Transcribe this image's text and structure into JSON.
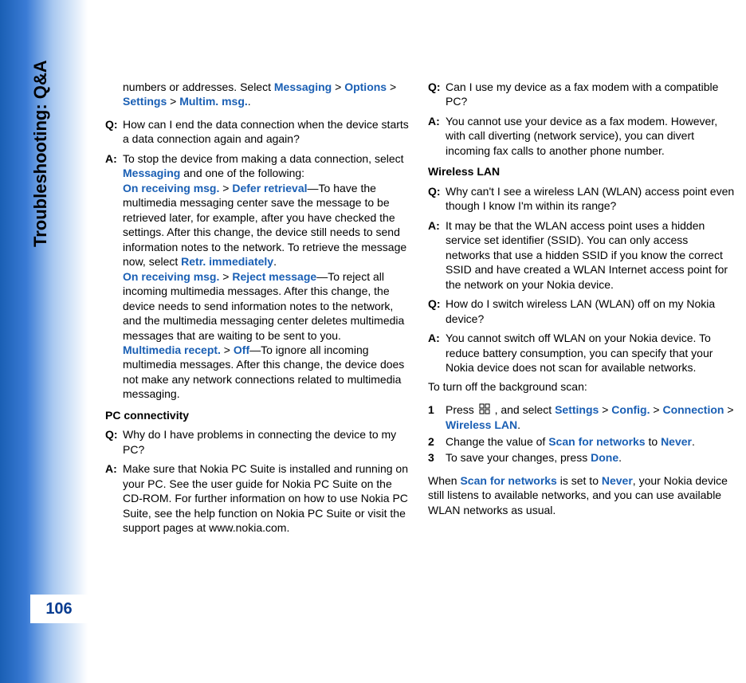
{
  "sidebar": {
    "title": "Troubleshooting: Q&A",
    "page_number": "106"
  },
  "col1": {
    "intro": {
      "pre": "numbers or addresses. Select ",
      "k1": "Messaging",
      "sep1": " > ",
      "k2": "Options",
      "sep2": " > ",
      "k3": "Settings",
      "sep3": " > ",
      "k4": "Multim. msg.",
      "post": "."
    },
    "q1": {
      "label": "Q:",
      "text": "How can I end the data connection when the device starts a data connection again and again?"
    },
    "a1": {
      "label": "A:",
      "line1_pre": "To stop the device from making a data connection, select ",
      "line1_k": "Messaging",
      "line1_post": " and one of the following:",
      "opt1_k1": "On receiving msg.",
      "opt1_sep": " > ",
      "opt1_k2": "Defer retrieval",
      "opt1_body": "—To have the multimedia messaging center save the message to be retrieved later, for example, after you have checked the settings. After this change, the device still needs to send information notes to the network. To retrieve the message now, select ",
      "opt1_k3": "Retr. immediately",
      "opt1_post": ".",
      "opt2_k1": "On receiving msg.",
      "opt2_sep": " > ",
      "opt2_k2": "Reject message",
      "opt2_body": "—To reject all incoming multimedia messages. After this change, the device needs to send information notes to the network, and the multimedia messaging center deletes multimedia messages that are waiting to be sent to you.",
      "opt3_k1": "Multimedia recept.",
      "opt3_sep": " > ",
      "opt3_k2": "Off",
      "opt3_body": "—To ignore all incoming multimedia messages. After this change, the device does not make any network connections related to multimedia messaging."
    },
    "sec_pc": "PC connectivity",
    "q2": {
      "label": "Q:",
      "text": "Why do I have problems in connecting the device to my PC?"
    },
    "a2": {
      "label": "A:",
      "text": "Make sure that Nokia PC Suite is installed and running on your PC. See the user guide for Nokia PC Suite on the CD-ROM. For further information on how to use Nokia PC Suite, see the help function on Nokia PC Suite or visit the support pages at www.nokia.com."
    }
  },
  "col2": {
    "q3": {
      "label": "Q:",
      "text": "Can I use my device as a fax modem with a compatible PC?"
    },
    "a3": {
      "label": "A:",
      "text": "You cannot use your device as a fax modem. However, with call diverting (network service), you can divert incoming fax calls to another phone number."
    },
    "sec_wlan": "Wireless LAN",
    "q4": {
      "label": "Q:",
      "text": "Why can't I see a wireless LAN (WLAN) access point even though I know I'm within its range?"
    },
    "a4": {
      "label": "A:",
      "text": "It may be that the WLAN access point uses a hidden service set identifier (SSID). You can only access networks that use a hidden SSID if you know the correct SSID and have created a WLAN Internet access point for the network on your Nokia device."
    },
    "q5": {
      "label": "Q:",
      "text": "How do I switch wireless LAN (WLAN) off on my Nokia device?"
    },
    "a5": {
      "label": "A:",
      "text": "You cannot switch off WLAN on your Nokia device. To reduce battery consumption, you can specify that your Nokia device does not scan for available networks."
    },
    "scan_intro": "To turn off the background scan:",
    "list": {
      "n1": "1",
      "i1_pre": "Press ",
      "i1_mid": " , and select ",
      "i1_k1": "Settings",
      "i1_s1": " > ",
      "i1_k2": "Config.",
      "i1_s2": " > ",
      "i1_k3": "Connection",
      "i1_s3": " > ",
      "i1_k4": "Wireless LAN",
      "i1_post": ".",
      "n2": "2",
      "i2_pre": "Change the value of ",
      "i2_k1": "Scan for networks",
      "i2_mid": " to ",
      "i2_k2": "Never",
      "i2_post": ".",
      "n3": "3",
      "i3_pre": "To save your changes, press ",
      "i3_k1": "Done",
      "i3_post": "."
    },
    "closing": {
      "pre": "When ",
      "k1": "Scan for networks",
      "mid": " is set to ",
      "k2": "Never",
      "post": ", your Nokia device still listens to available networks, and you can use available WLAN networks as usual."
    }
  }
}
